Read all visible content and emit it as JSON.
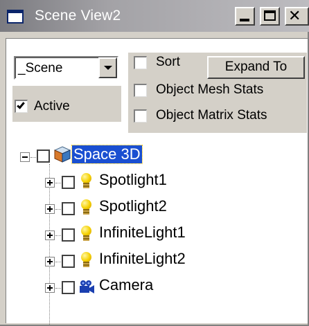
{
  "window": {
    "title": "Scene View2",
    "close_glyph": "✕"
  },
  "toolbar": {
    "scene_select_value": "_Scene",
    "active_label": "Active",
    "active_checked": true,
    "sort_label": "Sort",
    "sort_checked": false,
    "expand_to_label": "Expand To",
    "mesh_stats_label": "Object Mesh Stats",
    "mesh_stats_checked": false,
    "matrix_stats_label": "Object Matrix Stats",
    "matrix_stats_checked": false
  },
  "tree": {
    "root": {
      "label": "Space 3D",
      "icon": "cube-icon",
      "selected": true,
      "expanded": true
    },
    "children": [
      {
        "label": "Spotlight1",
        "icon": "lightbulb-icon"
      },
      {
        "label": "Spotlight2",
        "icon": "lightbulb-icon"
      },
      {
        "label": "InfiniteLight1",
        "icon": "lightbulb-icon"
      },
      {
        "label": "InfiniteLight2",
        "icon": "lightbulb-icon"
      },
      {
        "label": "Camera",
        "icon": "camera-icon"
      }
    ]
  },
  "colors": {
    "selection": "#1a4fd1",
    "face": "#d4d0c8"
  }
}
